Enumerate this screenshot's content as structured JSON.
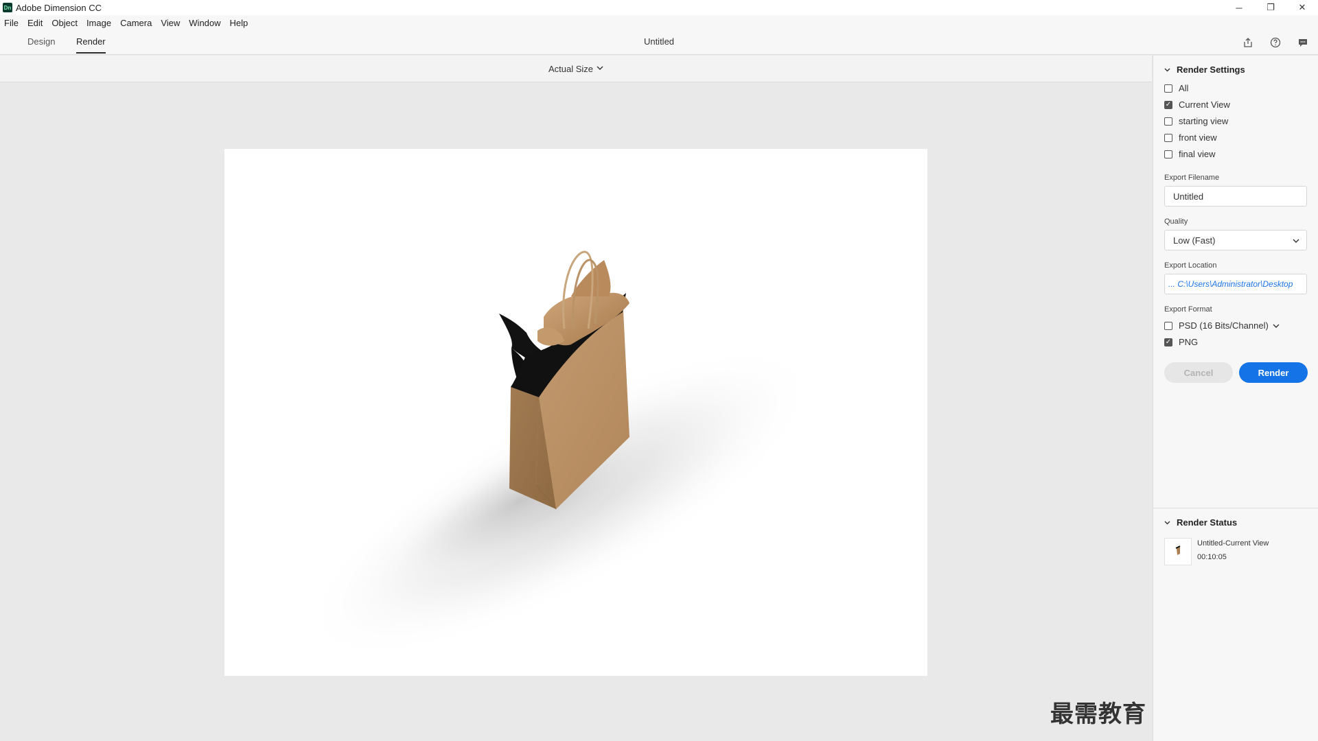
{
  "window": {
    "app_title": "Adobe Dimension CC",
    "logo_text": "Dn",
    "controls": {
      "minimize": "─",
      "restore": "❐",
      "close": "✕"
    }
  },
  "menu": [
    "File",
    "Edit",
    "Object",
    "Image",
    "Camera",
    "View",
    "Window",
    "Help"
  ],
  "mode_tabs": [
    {
      "label": "Design",
      "active": false
    },
    {
      "label": "Render",
      "active": true
    }
  ],
  "document_title": "Untitled",
  "top_icons": [
    "share-icon",
    "help-icon",
    "comment-icon"
  ],
  "canvas": {
    "zoom_label": "Actual Size",
    "scene_subject": "kraft paper shopping bag with tissue",
    "watermark": "最需教育"
  },
  "render_settings": {
    "title": "Render Settings",
    "views": [
      {
        "label": "All",
        "checked": false
      },
      {
        "label": "Current View",
        "checked": true
      },
      {
        "label": "starting view",
        "checked": false
      },
      {
        "label": "front view",
        "checked": false
      },
      {
        "label": "final view",
        "checked": false
      }
    ],
    "export_filename_label": "Export Filename",
    "export_filename_value": "Untitled",
    "quality_label": "Quality",
    "quality_value": "Low (Fast)",
    "export_location_label": "Export Location",
    "export_location_value": "... C:\\Users\\Administrator\\Desktop",
    "export_format_label": "Export Format",
    "formats": [
      {
        "label": "PSD (16 Bits/Channel)",
        "checked": false,
        "has_dropdown": true
      },
      {
        "label": "PNG",
        "checked": true,
        "has_dropdown": false
      }
    ],
    "cancel_label": "Cancel",
    "render_label": "Render"
  },
  "render_status": {
    "title": "Render Status",
    "item_name": "Untitled-Current View",
    "item_time": "00:10:05"
  },
  "colors": {
    "accent": "#1473e6",
    "link": "#1a73e8",
    "panel_bg": "#f7f7f7",
    "canvas_bg": "#e9e9e9"
  }
}
